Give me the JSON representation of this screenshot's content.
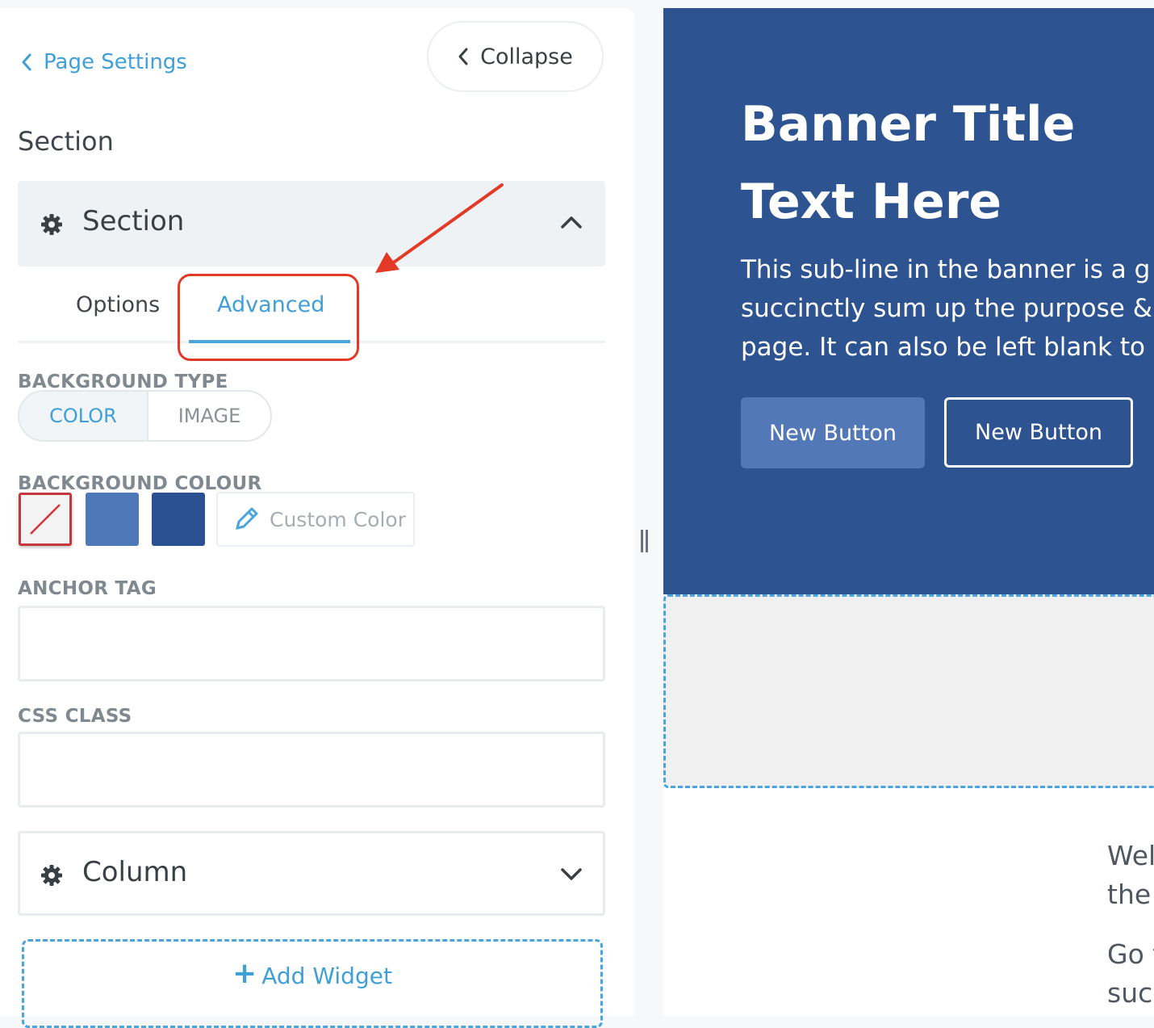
{
  "sidebar": {
    "back_label": "Page Settings",
    "collapse_label": "Collapse",
    "section_heading": "Section",
    "section_accordion": {
      "title": "Section",
      "icon": "gear-icon",
      "state": "expanded"
    },
    "tabs": [
      {
        "label": "Options",
        "active": false
      },
      {
        "label": "Advanced",
        "active": true
      }
    ],
    "background_type": {
      "label": "BACKGROUND TYPE",
      "options": [
        "COLOR",
        "IMAGE"
      ],
      "selected": "COLOR"
    },
    "background_colour": {
      "label": "BACKGROUND COLOUR",
      "swatches": [
        {
          "name": "none",
          "color": "#f3f3f4",
          "selected": true
        },
        {
          "name": "light-blue",
          "color": "#4f78b8",
          "selected": false
        },
        {
          "name": "dark-blue",
          "color": "#2c5192",
          "selected": false
        }
      ],
      "custom_label": "Custom Color"
    },
    "anchor_tag": {
      "label": "ANCHOR TAG",
      "value": "",
      "placeholder": ""
    },
    "css_class": {
      "label": "CSS CLASS",
      "value": "",
      "placeholder": ""
    },
    "column_accordion": {
      "title": "Column",
      "icon": "gear-icon",
      "state": "collapsed"
    },
    "add_widget_label": "Add Widget"
  },
  "preview": {
    "banner": {
      "title": "Banner Title Text Here",
      "subtitle": "This sub-line in the banner is a g\nsuccinctly sum up the purpose &\npage. It can also be left blank to",
      "primary_button": "New Button",
      "secondary_button": "New Button",
      "background": "#2e5391"
    },
    "body_paragraph_1": "Wel\nthe",
    "body_paragraph_2": "Go t\nsucl"
  },
  "colors": {
    "accent": "#3fa0d8",
    "annotation_red": "#e23a27"
  }
}
